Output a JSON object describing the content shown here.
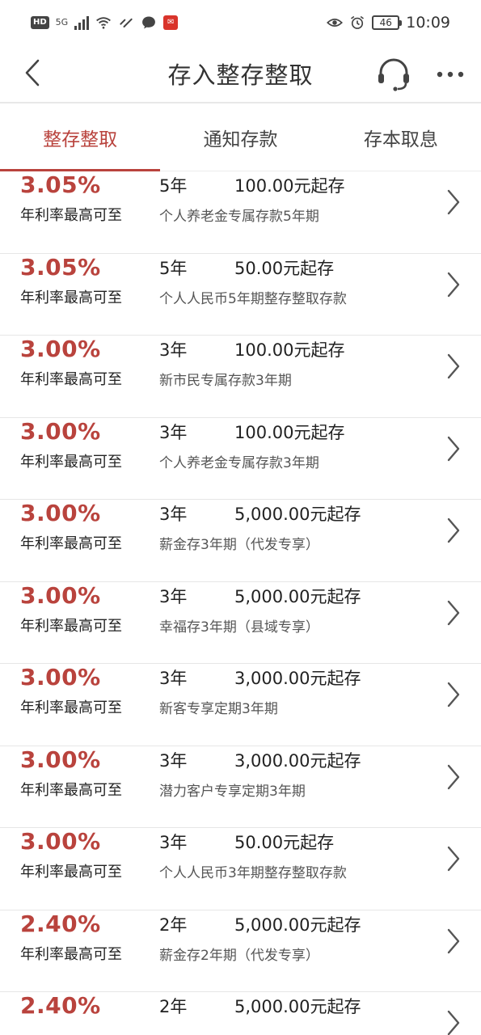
{
  "status_bar": {
    "hd": "HD",
    "net": "5G",
    "battery": "46",
    "time": "10:09"
  },
  "header": {
    "title": "存入整存整取"
  },
  "tabs": [
    {
      "label": "整存整取",
      "active": true
    },
    {
      "label": "通知存款",
      "active": false
    },
    {
      "label": "存本取息",
      "active": false
    }
  ],
  "products": [
    {
      "rate": "3.05%",
      "rate_label": "年利率最高可至",
      "term": "5年",
      "min": "100.00元起存",
      "name": "个人养老金专属存款5年期"
    },
    {
      "rate": "3.05%",
      "rate_label": "年利率最高可至",
      "term": "5年",
      "min": "50.00元起存",
      "name": "个人人民币5年期整存整取存款"
    },
    {
      "rate": "3.00%",
      "rate_label": "年利率最高可至",
      "term": "3年",
      "min": "100.00元起存",
      "name": "新市民专属存款3年期"
    },
    {
      "rate": "3.00%",
      "rate_label": "年利率最高可至",
      "term": "3年",
      "min": "100.00元起存",
      "name": "个人养老金专属存款3年期"
    },
    {
      "rate": "3.00%",
      "rate_label": "年利率最高可至",
      "term": "3年",
      "min": "5,000.00元起存",
      "name": "薪金存3年期（代发专享）"
    },
    {
      "rate": "3.00%",
      "rate_label": "年利率最高可至",
      "term": "3年",
      "min": "5,000.00元起存",
      "name": "幸福存3年期（县域专享）"
    },
    {
      "rate": "3.00%",
      "rate_label": "年利率最高可至",
      "term": "3年",
      "min": "3,000.00元起存",
      "name": "新客专享定期3年期"
    },
    {
      "rate": "3.00%",
      "rate_label": "年利率最高可至",
      "term": "3年",
      "min": "3,000.00元起存",
      "name": "潜力客户专享定期3年期"
    },
    {
      "rate": "3.00%",
      "rate_label": "年利率最高可至",
      "term": "3年",
      "min": "50.00元起存",
      "name": "个人人民币3年期整存整取存款"
    },
    {
      "rate": "2.40%",
      "rate_label": "年利率最高可至",
      "term": "2年",
      "min": "5,000.00元起存",
      "name": "薪金存2年期（代发专享）"
    },
    {
      "rate": "2.40%",
      "rate_label": "",
      "term": "2年",
      "min": "5,000.00元起存",
      "name": ""
    }
  ],
  "colors": {
    "accent": "#b9433d"
  }
}
